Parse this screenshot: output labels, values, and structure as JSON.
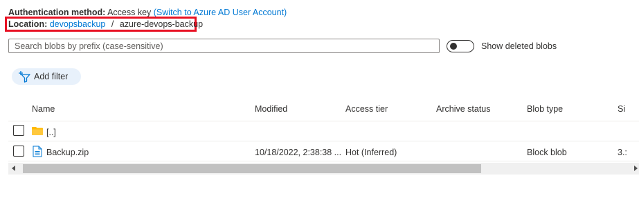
{
  "auth": {
    "label": "Authentication method:",
    "value": "Access key",
    "switch_link": "(Switch to Azure AD User Account)"
  },
  "location": {
    "label": "Location:",
    "account_link": "devopsbackup",
    "separator": "/",
    "container": "azure-devops-backup"
  },
  "search": {
    "placeholder": "Search blobs by prefix (case-sensitive)",
    "value": ""
  },
  "deleted_toggle": {
    "label": "Show deleted blobs",
    "state": "off"
  },
  "filter": {
    "label": "Add filter",
    "icon": "add-filter-icon"
  },
  "table": {
    "columns": [
      "Name",
      "Modified",
      "Access tier",
      "Archive status",
      "Blob type",
      "Si"
    ],
    "rows": [
      {
        "icon": "folder-icon",
        "name": "[..]",
        "modified": "",
        "access_tier": "",
        "archive_status": "",
        "blob_type": "",
        "size": ""
      },
      {
        "icon": "file-icon",
        "name": "Backup.zip",
        "modified": "10/18/2022, 2:38:38 ...",
        "access_tier": "Hot (Inferred)",
        "archive_status": "",
        "blob_type": "Block blob",
        "size": "3.:"
      }
    ]
  },
  "colors": {
    "link": "#0078d4",
    "highlight_border": "#e81123",
    "folder": "#ffb900",
    "filter_button_bg": "#e8f1fb"
  }
}
